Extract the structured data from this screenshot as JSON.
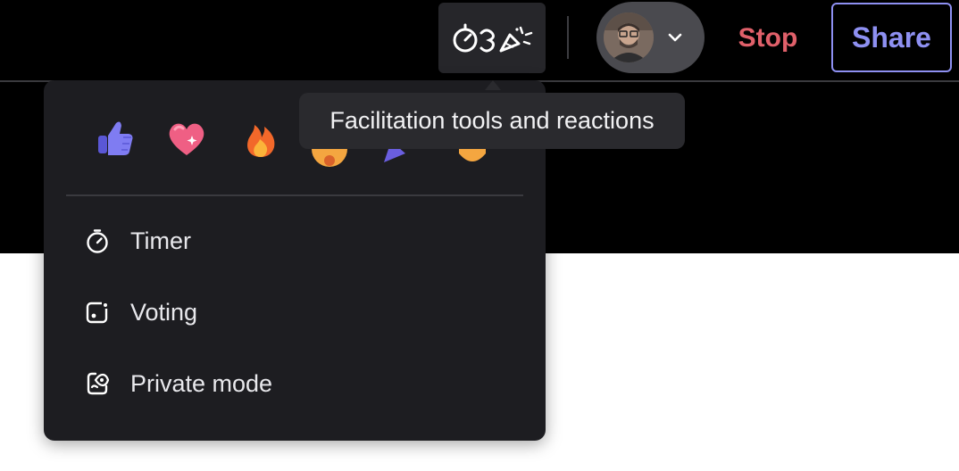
{
  "toolbar": {
    "facilitation_icon": "timer-and-party-popper-icon",
    "avatar_icon": "user-avatar",
    "chevron_icon": "chevron-down-icon",
    "stop_label": "Stop",
    "share_label": "Share"
  },
  "tooltip": {
    "text": "Facilitation tools and reactions"
  },
  "menu": {
    "reactions": [
      "thumbs-up-icon",
      "sparkling-heart-icon",
      "fire-icon",
      "face-emoji-icon",
      "party-popper-icon",
      "clapping-hands-icon"
    ],
    "items": [
      {
        "label": "Timer",
        "icon": "timer-icon"
      },
      {
        "label": "Voting",
        "icon": "voting-icon"
      },
      {
        "label": "Private mode",
        "icon": "private-mode-icon"
      }
    ]
  },
  "colors": {
    "stop": "#e0606a",
    "share": "#8e90f2",
    "menu_bg": "#1d1d21",
    "tooltip_bg": "#2a2a2e"
  }
}
